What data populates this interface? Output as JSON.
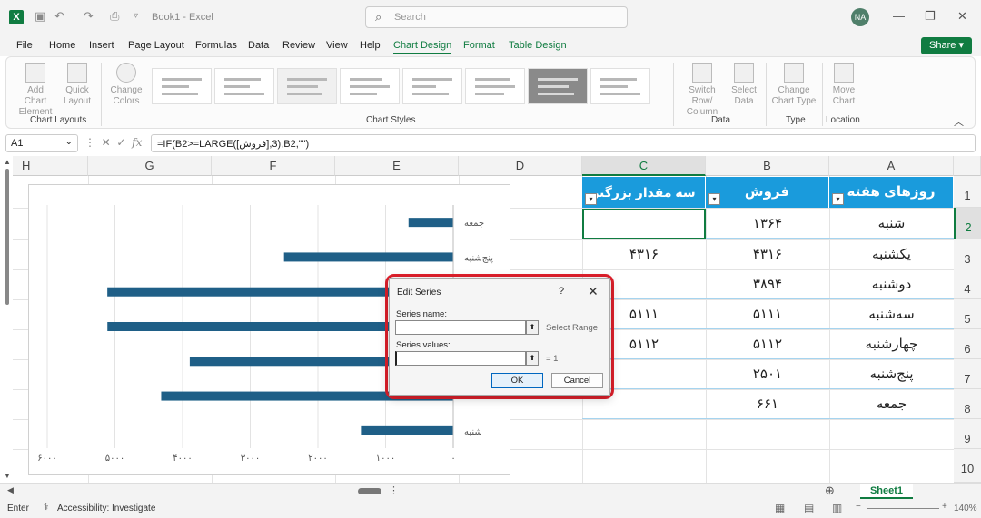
{
  "titlebar": {
    "app_badge": "X",
    "doc_title": "Book1 - Excel",
    "search_placeholder": "Search",
    "user_initials": "NA"
  },
  "menu": {
    "items": [
      "File",
      "Home",
      "Insert",
      "Page Layout",
      "Formulas",
      "Data",
      "Review",
      "View",
      "Help",
      "Chart Design",
      "Format",
      "Table Design"
    ],
    "active": "Chart Design",
    "share": "Share"
  },
  "ribbon": {
    "add_chart_element": "Add Chart Element",
    "quick_layout": "Quick Layout",
    "change_colors": "Change Colors",
    "switch_row_column": "Switch Row/ Column",
    "select_data": "Select Data",
    "change_chart_type": "Change Chart Type",
    "move_chart": "Move Chart",
    "groups": {
      "chart_layouts": "Chart Layouts",
      "chart_styles": "Chart Styles",
      "data": "Data",
      "type": "Type",
      "location": "Location"
    }
  },
  "formula_bar": {
    "cell_ref": "A1",
    "formula": "=IF(B2>=LARGE([فروش],3),B2,\"\")"
  },
  "columns": {
    "headers": [
      "H",
      "G",
      "F",
      "E",
      "D",
      "C",
      "B",
      "A"
    ],
    "rows": [
      "1",
      "2",
      "3",
      "4",
      "5",
      "6",
      "7",
      "8",
      "9",
      "10"
    ]
  },
  "table": {
    "headers": {
      "A": "روزهای هفته",
      "B": "فروش",
      "C": "سه مقدار بزرگتر"
    },
    "rows": [
      {
        "A": "شنبه",
        "B": "۱۳۶۴",
        "C": ""
      },
      {
        "A": "یکشنبه",
        "B": "۴۳۱۶",
        "C": "۴۳۱۶"
      },
      {
        "A": "دوشنبه",
        "B": "۳۸۹۴",
        "C": ""
      },
      {
        "A": "سه‌شنبه",
        "B": "۵۱۱۱",
        "C": "۵۱۱۱"
      },
      {
        "A": "چهارشنبه",
        "B": "۵۱۱۲",
        "C": "۵۱۱۲"
      },
      {
        "A": "پنج‌شنبه",
        "B": "۲۵۰۱",
        "C": ""
      },
      {
        "A": "جمعه",
        "B": "۶۶۱",
        "C": ""
      }
    ]
  },
  "chart_data": {
    "type": "bar",
    "orientation": "horizontal",
    "x_reversed": true,
    "color": "#1f5f87",
    "categories": [
      "شنبه",
      "یکشنبه",
      "دوشنبه",
      "سه‌شنبه",
      "چهارشنبه",
      "پنج‌شنبه",
      "جمعه"
    ],
    "values": [
      1364,
      4316,
      3894,
      5111,
      5112,
      2501,
      661
    ],
    "visible_category_labels": [
      "جمعه",
      "پنج‌شنبه",
      "شنبه"
    ],
    "xlim": [
      0,
      6000
    ],
    "x_ticks": [
      0,
      1000,
      2000,
      3000,
      4000,
      5000,
      6000
    ],
    "x_tick_labels": [
      "۰",
      "۱۰۰۰",
      "۲۰۰۰",
      "۳۰۰۰",
      "۴۰۰۰",
      "۵۰۰۰",
      "۶۰۰۰"
    ],
    "grid": true
  },
  "dialog": {
    "title": "Edit Series",
    "help": "?",
    "series_name_label": "Series name:",
    "series_name_value": "",
    "select_range": "Select Range",
    "series_values_label": "Series values:",
    "series_values_value": "",
    "values_preview": "= 1",
    "ok": "OK",
    "cancel": "Cancel"
  },
  "sheet": {
    "tab": "Sheet1"
  },
  "status": {
    "mode": "Enter",
    "accessibility": "Accessibility: Investigate",
    "zoom": "140%"
  }
}
